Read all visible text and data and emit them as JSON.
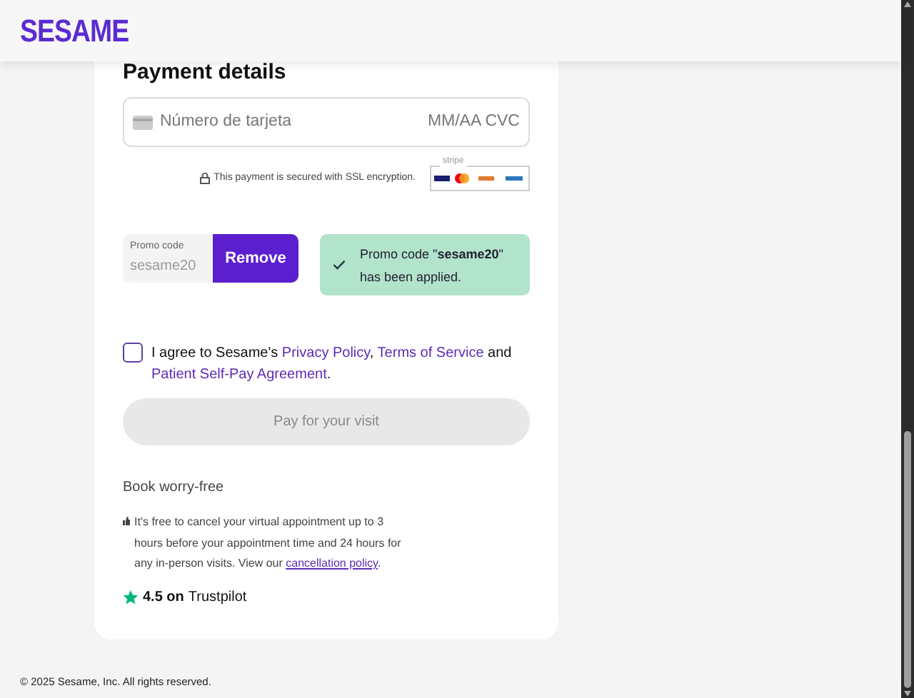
{
  "header": {
    "logo": "SESAME"
  },
  "payment": {
    "title": "Payment details",
    "card_field": {
      "placeholder": "Número de tarjeta",
      "expiry_cvc_placeholder": "MM/AA CVC"
    },
    "security_note": "This payment is secured with SSL encryption.",
    "stripe_label": "stripe"
  },
  "promo": {
    "label": "Promo code",
    "value": "sesame20",
    "disabled": true,
    "button": "Remove",
    "message": "Promo code \"**sesame20**\" has been applied."
  },
  "agreement": {
    "checked": false,
    "parts": [
      {
        "kind": "text",
        "text": "I agree to Sesame's "
      },
      {
        "kind": "link",
        "text": "Privacy Policy"
      },
      {
        "kind": "text",
        "text": ", "
      },
      {
        "kind": "link",
        "text": "Terms of Service"
      },
      {
        "kind": "text",
        "text": " and "
      },
      {
        "kind": "link",
        "text": "Patient Self-Pay Agreement"
      },
      {
        "kind": "text",
        "text": "."
      }
    ]
  },
  "pay_button": {
    "label": "Pay for your visit",
    "disabled": true
  },
  "worry_free": {
    "title": "Book worry-free",
    "parts": [
      {
        "kind": "text",
        "text": "It's free to cancel your virtual appointment up to 3 hours before your appointment time and 24 hours for any in-person visits. View our "
      },
      {
        "kind": "link",
        "text": "cancellation policy"
      },
      {
        "kind": "text",
        "text": "."
      }
    ]
  },
  "rating": {
    "score": "4.5 on",
    "brand": "Trustpilot"
  },
  "footer": {
    "copyright": "© 2025 Sesame, Inc. All rights reserved."
  }
}
